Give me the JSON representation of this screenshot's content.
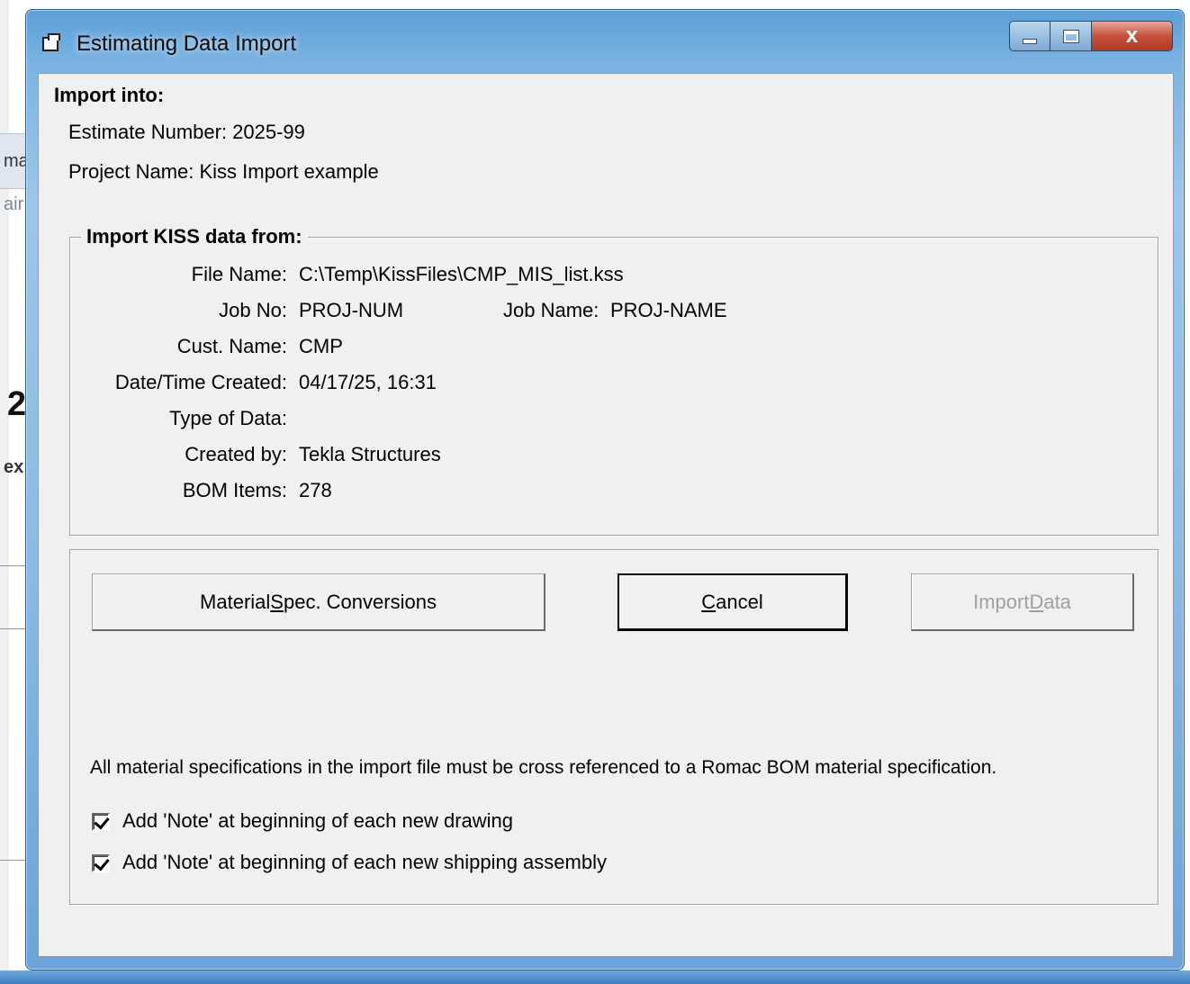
{
  "window": {
    "title": "Estimating Data Import",
    "close_glyph": "x"
  },
  "import_into": {
    "heading": "Import into:",
    "estimate_number": "Estimate Number: 2025-99",
    "project_name": "Project Name: Kiss Import example"
  },
  "kiss_group": {
    "legend": "Import KISS data from:",
    "fields": {
      "file_name_label": "File Name:",
      "file_name_value": "C:\\Temp\\KissFiles\\CMP_MIS_list.kss",
      "job_no_label": "Job No:",
      "job_no_value": "PROJ-NUM",
      "job_name_label": "Job Name:",
      "job_name_value": "PROJ-NAME",
      "cust_name_label": "Cust. Name:",
      "cust_name_value": "CMP",
      "date_created_label": "Date/Time Created:",
      "date_created_value": "04/17/25, 16:31",
      "type_of_data_label": "Type of Data:",
      "type_of_data_value": "",
      "created_by_label": "Created by:",
      "created_by_value": "Tekla Structures",
      "bom_items_label": "BOM Items:",
      "bom_items_value": "278"
    }
  },
  "buttons": {
    "material_spec": {
      "pre": "Material ",
      "accel": "S",
      "post": "pec. Conversions"
    },
    "cancel": {
      "pre": "",
      "accel": "C",
      "post": "ancel"
    },
    "import_data": {
      "pre": "Import ",
      "accel": "D",
      "post": "ata",
      "enabled": false
    }
  },
  "notice": "All material specifications in the import file must be cross referenced to a Romac BOM material specification.",
  "checkboxes": [
    {
      "label": "Add 'Note' at beginning of each new drawing",
      "checked": true
    },
    {
      "label": "Add 'Note' at beginning of each new shipping assembly",
      "checked": true
    }
  ],
  "background_app": {
    "fragments": [
      "ma",
      "air",
      "2",
      "ex"
    ]
  },
  "colors": {
    "frame": "#7db4e3",
    "client": "#f0f0f0",
    "close_button": "#c7513a",
    "disabled_text": "#a0a0a0"
  }
}
